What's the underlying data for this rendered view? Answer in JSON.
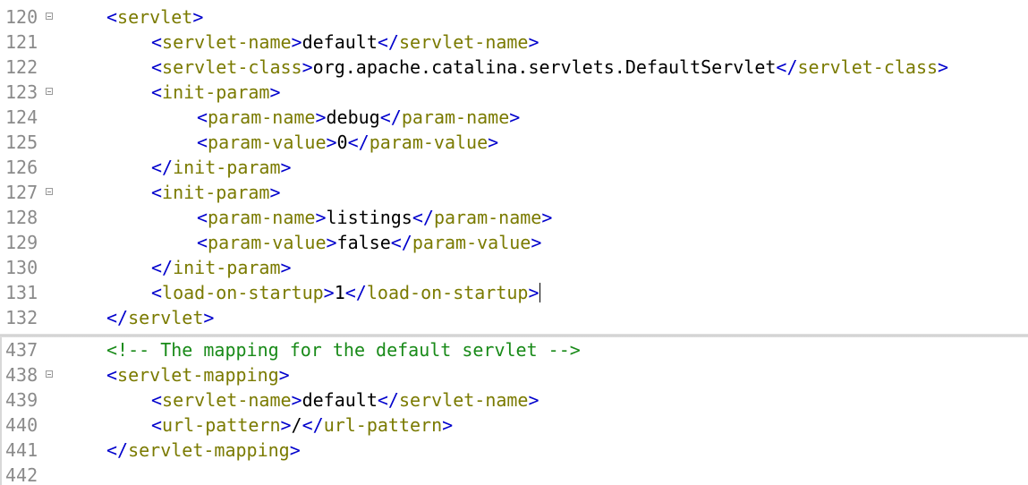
{
  "top_lines": [
    {
      "num": "120",
      "fold": true,
      "indent": 1,
      "parts": [
        {
          "k": "b",
          "v": "<"
        },
        {
          "k": "t",
          "v": "servlet"
        },
        {
          "k": "b",
          "v": ">"
        }
      ]
    },
    {
      "num": "121",
      "fold": false,
      "indent": 2,
      "parts": [
        {
          "k": "b",
          "v": "<"
        },
        {
          "k": "t",
          "v": "servlet-name"
        },
        {
          "k": "b",
          "v": ">"
        },
        {
          "k": "x",
          "v": "default"
        },
        {
          "k": "b",
          "v": "</"
        },
        {
          "k": "t",
          "v": "servlet-name"
        },
        {
          "k": "b",
          "v": ">"
        }
      ]
    },
    {
      "num": "122",
      "fold": false,
      "indent": 2,
      "parts": [
        {
          "k": "b",
          "v": "<"
        },
        {
          "k": "t",
          "v": "servlet-class"
        },
        {
          "k": "b",
          "v": ">"
        },
        {
          "k": "x",
          "v": "org.apache.catalina.servlets.DefaultServlet"
        },
        {
          "k": "b",
          "v": "</"
        },
        {
          "k": "t",
          "v": "servlet-class"
        },
        {
          "k": "b",
          "v": ">"
        }
      ]
    },
    {
      "num": "123",
      "fold": true,
      "indent": 2,
      "parts": [
        {
          "k": "b",
          "v": "<"
        },
        {
          "k": "t",
          "v": "init-param"
        },
        {
          "k": "b",
          "v": ">"
        }
      ]
    },
    {
      "num": "124",
      "fold": false,
      "indent": 3,
      "parts": [
        {
          "k": "b",
          "v": "<"
        },
        {
          "k": "t",
          "v": "param-name"
        },
        {
          "k": "b",
          "v": ">"
        },
        {
          "k": "x",
          "v": "debug"
        },
        {
          "k": "b",
          "v": "</"
        },
        {
          "k": "t",
          "v": "param-name"
        },
        {
          "k": "b",
          "v": ">"
        }
      ]
    },
    {
      "num": "125",
      "fold": false,
      "indent": 3,
      "parts": [
        {
          "k": "b",
          "v": "<"
        },
        {
          "k": "t",
          "v": "param-value"
        },
        {
          "k": "b",
          "v": ">"
        },
        {
          "k": "x",
          "v": "0"
        },
        {
          "k": "b",
          "v": "</"
        },
        {
          "k": "t",
          "v": "param-value"
        },
        {
          "k": "b",
          "v": ">"
        }
      ]
    },
    {
      "num": "126",
      "fold": false,
      "indent": 2,
      "parts": [
        {
          "k": "b",
          "v": "</"
        },
        {
          "k": "t",
          "v": "init-param"
        },
        {
          "k": "b",
          "v": ">"
        }
      ]
    },
    {
      "num": "127",
      "fold": true,
      "indent": 2,
      "parts": [
        {
          "k": "b",
          "v": "<"
        },
        {
          "k": "t",
          "v": "init-param"
        },
        {
          "k": "b",
          "v": ">"
        }
      ]
    },
    {
      "num": "128",
      "fold": false,
      "indent": 3,
      "parts": [
        {
          "k": "b",
          "v": "<"
        },
        {
          "k": "t",
          "v": "param-name"
        },
        {
          "k": "b",
          "v": ">"
        },
        {
          "k": "x",
          "v": "listings"
        },
        {
          "k": "b",
          "v": "</"
        },
        {
          "k": "t",
          "v": "param-name"
        },
        {
          "k": "b",
          "v": ">"
        }
      ]
    },
    {
      "num": "129",
      "fold": false,
      "indent": 3,
      "parts": [
        {
          "k": "b",
          "v": "<"
        },
        {
          "k": "t",
          "v": "param-value"
        },
        {
          "k": "b",
          "v": ">"
        },
        {
          "k": "x",
          "v": "false"
        },
        {
          "k": "b",
          "v": "</"
        },
        {
          "k": "t",
          "v": "param-value"
        },
        {
          "k": "b",
          "v": ">"
        }
      ]
    },
    {
      "num": "130",
      "fold": false,
      "indent": 2,
      "parts": [
        {
          "k": "b",
          "v": "</"
        },
        {
          "k": "t",
          "v": "init-param"
        },
        {
          "k": "b",
          "v": ">"
        }
      ]
    },
    {
      "num": "131",
      "fold": false,
      "indent": 2,
      "caret": true,
      "parts": [
        {
          "k": "b",
          "v": "<"
        },
        {
          "k": "t",
          "v": "load-on-startup"
        },
        {
          "k": "b",
          "v": ">"
        },
        {
          "k": "x",
          "v": "1"
        },
        {
          "k": "b",
          "v": "</"
        },
        {
          "k": "t",
          "v": "load-on-startup"
        },
        {
          "k": "b",
          "v": ">"
        }
      ]
    },
    {
      "num": "132",
      "fold": false,
      "indent": 1,
      "parts": [
        {
          "k": "b",
          "v": "</"
        },
        {
          "k": "t",
          "v": "servlet"
        },
        {
          "k": "b",
          "v": ">"
        }
      ]
    }
  ],
  "bottom_lines": [
    {
      "num": "437",
      "fold": false,
      "indent": 1,
      "parts": [
        {
          "k": "c",
          "v": "<!-- The mapping for the default servlet -->"
        }
      ]
    },
    {
      "num": "438",
      "fold": true,
      "indent": 1,
      "parts": [
        {
          "k": "b",
          "v": "<"
        },
        {
          "k": "t",
          "v": "servlet-mapping"
        },
        {
          "k": "b",
          "v": ">"
        }
      ]
    },
    {
      "num": "439",
      "fold": false,
      "indent": 2,
      "parts": [
        {
          "k": "b",
          "v": "<"
        },
        {
          "k": "t",
          "v": "servlet-name"
        },
        {
          "k": "b",
          "v": ">"
        },
        {
          "k": "x",
          "v": "default"
        },
        {
          "k": "b",
          "v": "</"
        },
        {
          "k": "t",
          "v": "servlet-name"
        },
        {
          "k": "b",
          "v": ">"
        }
      ]
    },
    {
      "num": "440",
      "fold": false,
      "indent": 2,
      "parts": [
        {
          "k": "b",
          "v": "<"
        },
        {
          "k": "t",
          "v": "url-pattern"
        },
        {
          "k": "b",
          "v": ">"
        },
        {
          "k": "x",
          "v": "/"
        },
        {
          "k": "b",
          "v": "</"
        },
        {
          "k": "t",
          "v": "url-pattern"
        },
        {
          "k": "b",
          "v": ">"
        }
      ]
    },
    {
      "num": "441",
      "fold": false,
      "indent": 1,
      "parts": [
        {
          "k": "b",
          "v": "</"
        },
        {
          "k": "t",
          "v": "servlet-mapping"
        },
        {
          "k": "b",
          "v": ">"
        }
      ]
    },
    {
      "num": "442",
      "fold": false,
      "indent": 1,
      "parts": []
    }
  ],
  "colors": {
    "bracket": "#0000cc",
    "tag_name": "#7a7a00",
    "text": "#000000",
    "comment": "#188a18",
    "line_number": "#8a8a8a"
  },
  "icons": {
    "fold_marker": "fold-collapse-icon"
  }
}
